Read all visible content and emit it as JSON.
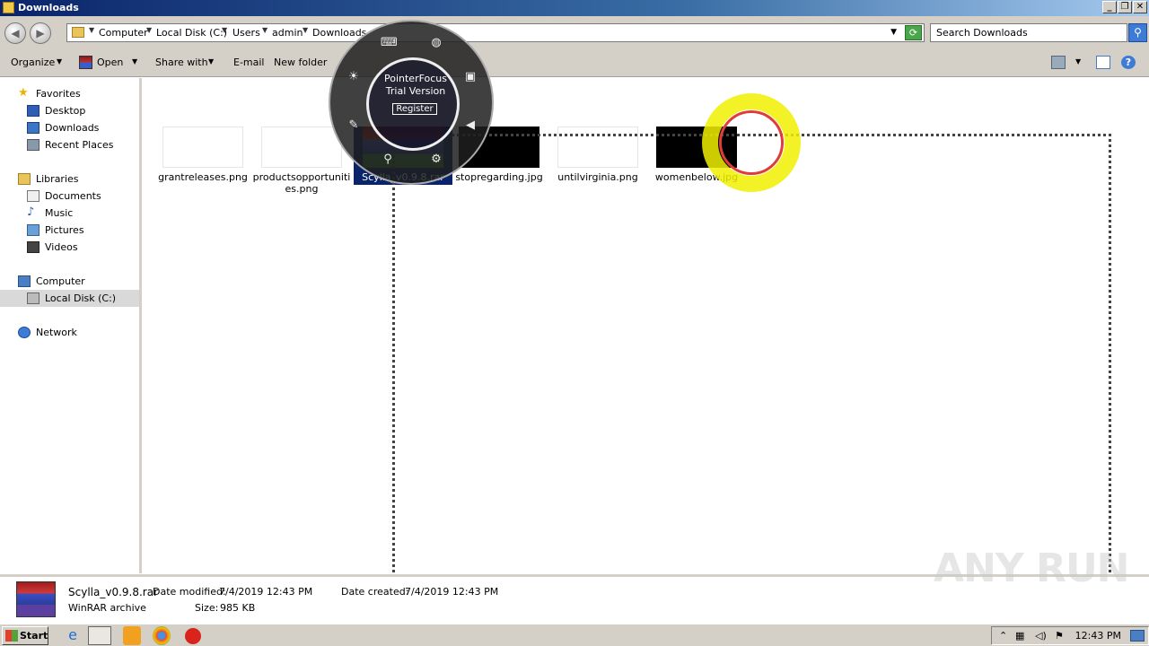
{
  "window": {
    "title": "Downloads"
  },
  "address": {
    "crumbs": [
      "Computer",
      "Local Disk (C:)",
      "Users",
      "admin",
      "Downloads"
    ],
    "search_placeholder": "Search Downloads"
  },
  "toolbar": {
    "organize": "Organize",
    "open": "Open",
    "share_with": "Share with",
    "email": "E-mail",
    "new_folder": "New folder"
  },
  "sidebar": {
    "favorites": "Favorites",
    "desktop": "Desktop",
    "downloads": "Downloads",
    "recent_places": "Recent Places",
    "libraries": "Libraries",
    "documents": "Documents",
    "music": "Music",
    "pictures": "Pictures",
    "videos": "Videos",
    "computer": "Computer",
    "local_disk": "Local Disk (C:)",
    "network": "Network"
  },
  "files": [
    {
      "name": "grantreleases.png"
    },
    {
      "name": "productsopportunities.png"
    },
    {
      "name": "Scylla_v0.9.8.rar"
    },
    {
      "name": "stopregarding.jpg"
    },
    {
      "name": "untilvirginia.png"
    },
    {
      "name": "womenbelow.jpg"
    }
  ],
  "details": {
    "filename": "Scylla_v0.9.8.rar",
    "type": "WinRAR archive",
    "date_modified_label": "Date modified:",
    "date_modified": "7/4/2019 12:43 PM",
    "date_created_label": "Date created:",
    "date_created": "7/4/2019 12:43 PM",
    "size_label": "Size:",
    "size": "985 KB"
  },
  "pointerfocus": {
    "title": "PointerFocus",
    "subtitle": "Trial Version",
    "register": "Register"
  },
  "taskbar": {
    "start": "Start",
    "clock": "12:43 PM"
  },
  "watermark": "ANY RUN"
}
